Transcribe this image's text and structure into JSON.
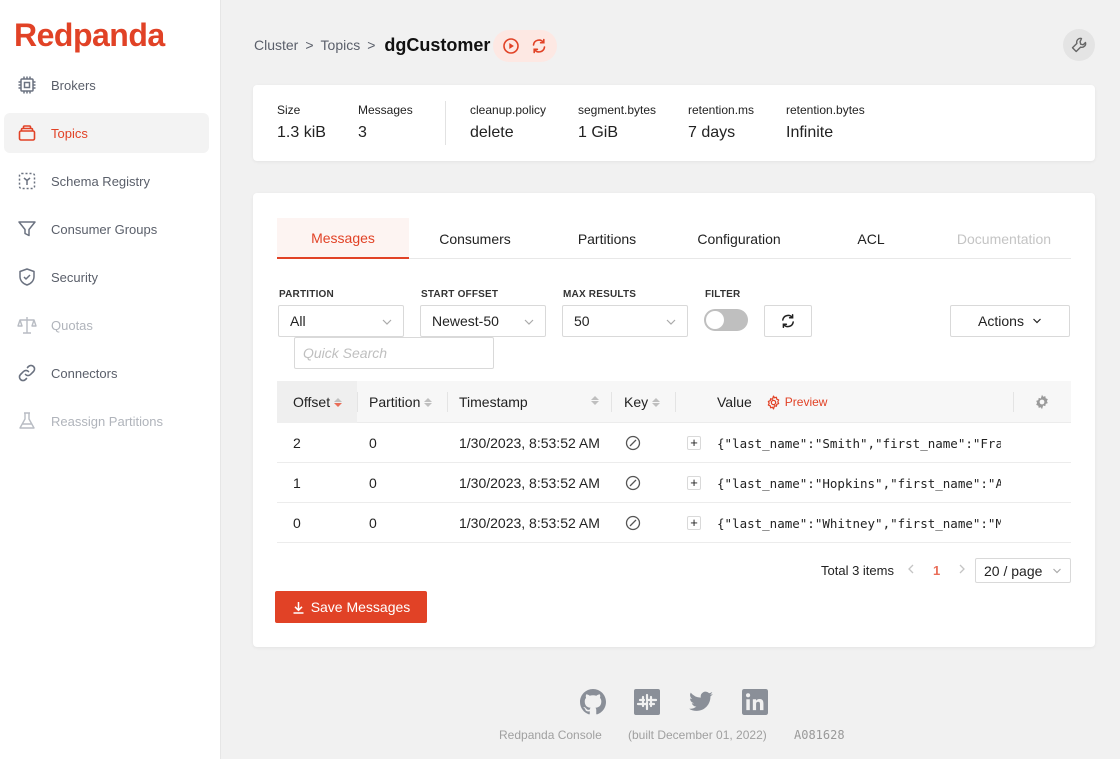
{
  "app": {
    "logo": "Redpanda",
    "brand_color": "#e14226"
  },
  "sidebar": {
    "items": [
      {
        "label": "Brokers",
        "icon": "chip-icon",
        "state": "normal"
      },
      {
        "label": "Topics",
        "icon": "topics-icon",
        "state": "active"
      },
      {
        "label": "Schema Registry",
        "icon": "schema-icon",
        "state": "normal"
      },
      {
        "label": "Consumer Groups",
        "icon": "funnel-icon",
        "state": "normal"
      },
      {
        "label": "Security",
        "icon": "shield-icon",
        "state": "normal"
      },
      {
        "label": "Quotas",
        "icon": "scale-icon",
        "state": "disabled"
      },
      {
        "label": "Connectors",
        "icon": "link-icon",
        "state": "normal"
      },
      {
        "label": "Reassign Partitions",
        "icon": "flask-icon",
        "state": "disabled"
      }
    ]
  },
  "header": {
    "breadcrumb": [
      "Cluster",
      "Topics"
    ],
    "separator": ">",
    "current": "dgCustomer"
  },
  "stats": [
    {
      "label": "Size",
      "value": "1.3 kiB"
    },
    {
      "label": "Messages",
      "value": "3"
    },
    {
      "label": "cleanup.policy",
      "value": "delete"
    },
    {
      "label": "segment.bytes",
      "value": "1 GiB"
    },
    {
      "label": "retention.ms",
      "value": "7 days"
    },
    {
      "label": "retention.bytes",
      "value": "Infinite"
    }
  ],
  "tabs": [
    {
      "label": "Messages",
      "state": "active"
    },
    {
      "label": "Consumers",
      "state": "normal"
    },
    {
      "label": "Partitions",
      "state": "normal"
    },
    {
      "label": "Configuration",
      "state": "normal"
    },
    {
      "label": "ACL",
      "state": "normal"
    },
    {
      "label": "Documentation",
      "state": "disabled"
    }
  ],
  "filters": {
    "partition": {
      "label": "PARTITION",
      "value": "All"
    },
    "start_offset": {
      "label": "START OFFSET",
      "value": "Newest-50"
    },
    "max_results": {
      "label": "MAX RESULTS",
      "value": "50"
    },
    "filter": {
      "label": "FILTER",
      "enabled": false
    },
    "actions_label": "Actions",
    "search_placeholder": "Quick Search"
  },
  "table": {
    "columns": [
      "Offset",
      "Partition",
      "Timestamp",
      "Key",
      "Value"
    ],
    "preview_label": "Preview",
    "rows": [
      {
        "offset": "2",
        "partition": "0",
        "timestamp": "1/30/2023, 8:53:52 AM",
        "value": "{\"last_name\":\"Smith\",\"first_name\":\"Franklin\"}"
      },
      {
        "offset": "1",
        "partition": "0",
        "timestamp": "1/30/2023, 8:53:52 AM",
        "value": "{\"last_name\":\"Hopkins\",\"first_name\":\"Ann\"}"
      },
      {
        "offset": "0",
        "partition": "0",
        "timestamp": "1/30/2023, 8:53:52 AM",
        "value": "{\"last_name\":\"Whitney\",\"first_name\":\"Mark\"}"
      }
    ]
  },
  "pagination": {
    "total": "Total 3 items",
    "current_page": "1",
    "page_size": "20 / page"
  },
  "save_button": "Save Messages",
  "footer": {
    "product": "Redpanda Console",
    "built": "(built December 01, 2022)",
    "hash": "A081628",
    "social": [
      "github-icon",
      "slack-icon",
      "twitter-icon",
      "linkedin-icon"
    ]
  }
}
